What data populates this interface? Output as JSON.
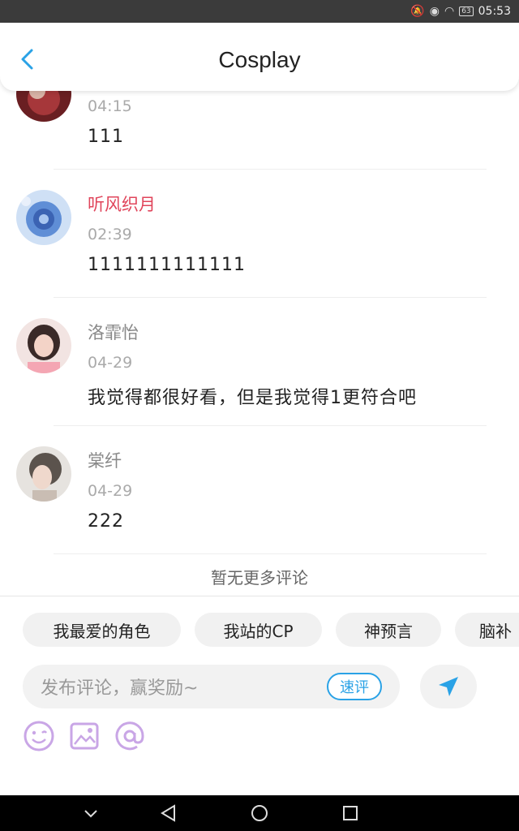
{
  "status_bar": {
    "time": "05:53",
    "battery": "63"
  },
  "header": {
    "title": "Cosplay"
  },
  "comments": [
    {
      "name": "",
      "time": "04:15",
      "text": "111",
      "avatar": "avatar-dark-red"
    },
    {
      "name": "听风织月",
      "name_color": "#e0455b",
      "time": "02:39",
      "text": "1111111111111",
      "avatar": "avatar-blue-rose"
    },
    {
      "name": "洛霏怡",
      "name_color": "#888888",
      "time": "04-29",
      "text": "我觉得都很好看，但是我觉得1更符合吧",
      "avatar": "avatar-girl-pink"
    },
    {
      "name": "棠纤",
      "name_color": "#888888",
      "time": "04-29",
      "text": "222",
      "avatar": "avatar-girl-grey"
    }
  ],
  "no_more_text": "暂无更多评论",
  "chips": [
    "我最爱的角色",
    "我站的CP",
    "神预言",
    "脑补"
  ],
  "input": {
    "placeholder": "发布评论，赢奖励~",
    "quick_label": "速评"
  },
  "tools": [
    "emoji-icon",
    "image-icon",
    "mention-icon"
  ],
  "colors": {
    "accent": "#2aa2e6",
    "highlight_name": "#e0455b",
    "tool_icon": "#c9a6e6"
  }
}
